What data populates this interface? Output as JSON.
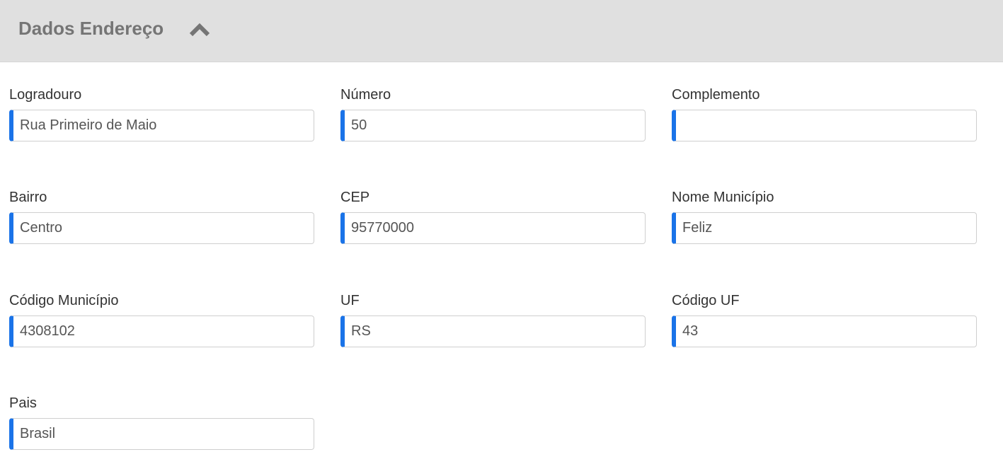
{
  "header": {
    "title": "Dados Endereço",
    "toggle_icon": "chevron-up-icon",
    "background": "#e0e0e0"
  },
  "accent_color": "#1a73e8",
  "fields": {
    "logradouro": {
      "label": "Logradouro",
      "value": "Rua Primeiro de Maio"
    },
    "numero": {
      "label": "Número",
      "value": "50"
    },
    "complemento": {
      "label": "Complemento",
      "value": ""
    },
    "bairro": {
      "label": "Bairro",
      "value": "Centro"
    },
    "cep": {
      "label": "CEP",
      "value": "95770000"
    },
    "nome_municipio": {
      "label": "Nome Município",
      "value": "Feliz"
    },
    "codigo_municipio": {
      "label": "Código Município",
      "value": "4308102"
    },
    "uf": {
      "label": "UF",
      "value": "RS"
    },
    "codigo_uf": {
      "label": "Código UF",
      "value": "43"
    },
    "pais": {
      "label": "Pais",
      "value": "Brasil"
    }
  }
}
